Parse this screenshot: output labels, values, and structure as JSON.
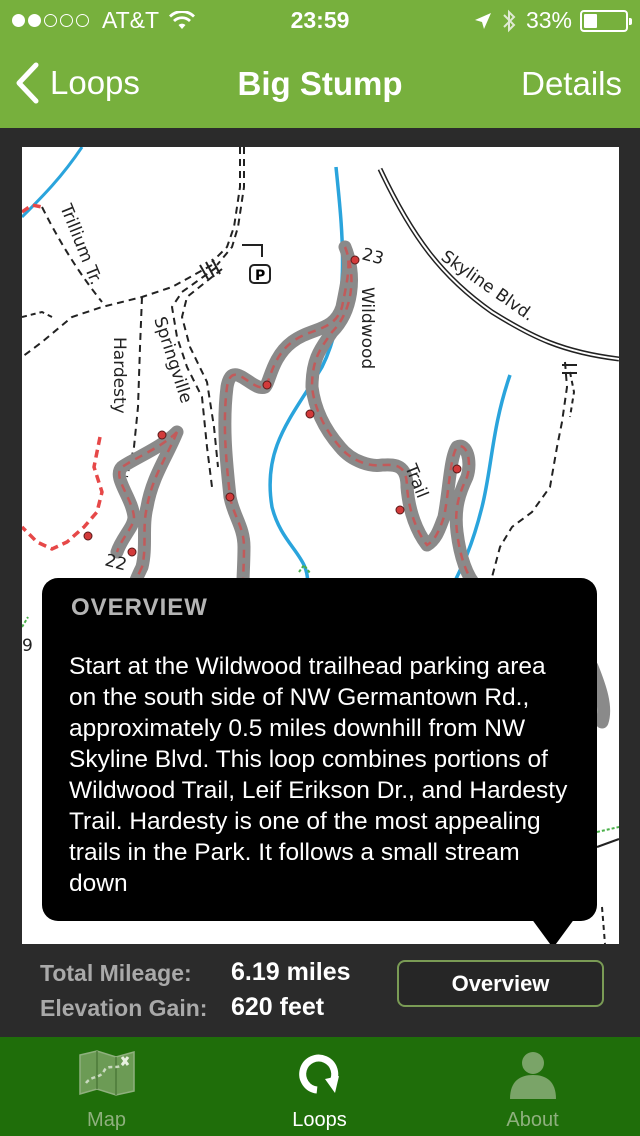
{
  "status_bar": {
    "carrier": "AT&T",
    "time": "23:59",
    "battery": "33%",
    "signal_bars_filled": 2,
    "signal_bars_total": 5
  },
  "nav": {
    "back_label": "Loops",
    "title": "Big Stump",
    "details_label": "Details"
  },
  "map": {
    "labels": {
      "trillium": "Trillium Tr.",
      "skyline": "Skyline Blvd.",
      "hardesty": "Hardesty",
      "springville": "Springville",
      "wildwood": "Wildwood",
      "trail": "Trail",
      "parking": "P",
      "marker_23": "23",
      "marker_22": "22",
      "marker_9": "9"
    }
  },
  "overview_popup": {
    "heading": "OVERVIEW",
    "body": "Start at the Wildwood trailhead parking area on the south side of NW Germantown Rd., approximately 0.5 miles downhill from NW Skyline Blvd. This loop combines portions of Wildwood Trail, Leif Erikson Dr., and Hardesty Trail. Hardesty is one of the most appealing trails in the Park. It follows a small stream down"
  },
  "stats": {
    "mileage_label": "Total Mileage:",
    "mileage_value": "6.19 miles",
    "elevation_label": "Elevation Gain:",
    "elevation_value": "620 feet",
    "overview_button": "Overview"
  },
  "tabbar": {
    "tabs": [
      {
        "label": "Map",
        "icon": "map-icon"
      },
      {
        "label": "Loops",
        "icon": "loop-icon",
        "active": true
      },
      {
        "label": "About",
        "icon": "person-icon"
      }
    ]
  },
  "colors": {
    "header_green": "#77b03d",
    "tabbar_green": "#1f6e0a",
    "route_gray": "#8a8a8a",
    "route_dash": "#c25a5a",
    "stream_blue": "#2aa4dc",
    "red_trail": "#e64848"
  }
}
